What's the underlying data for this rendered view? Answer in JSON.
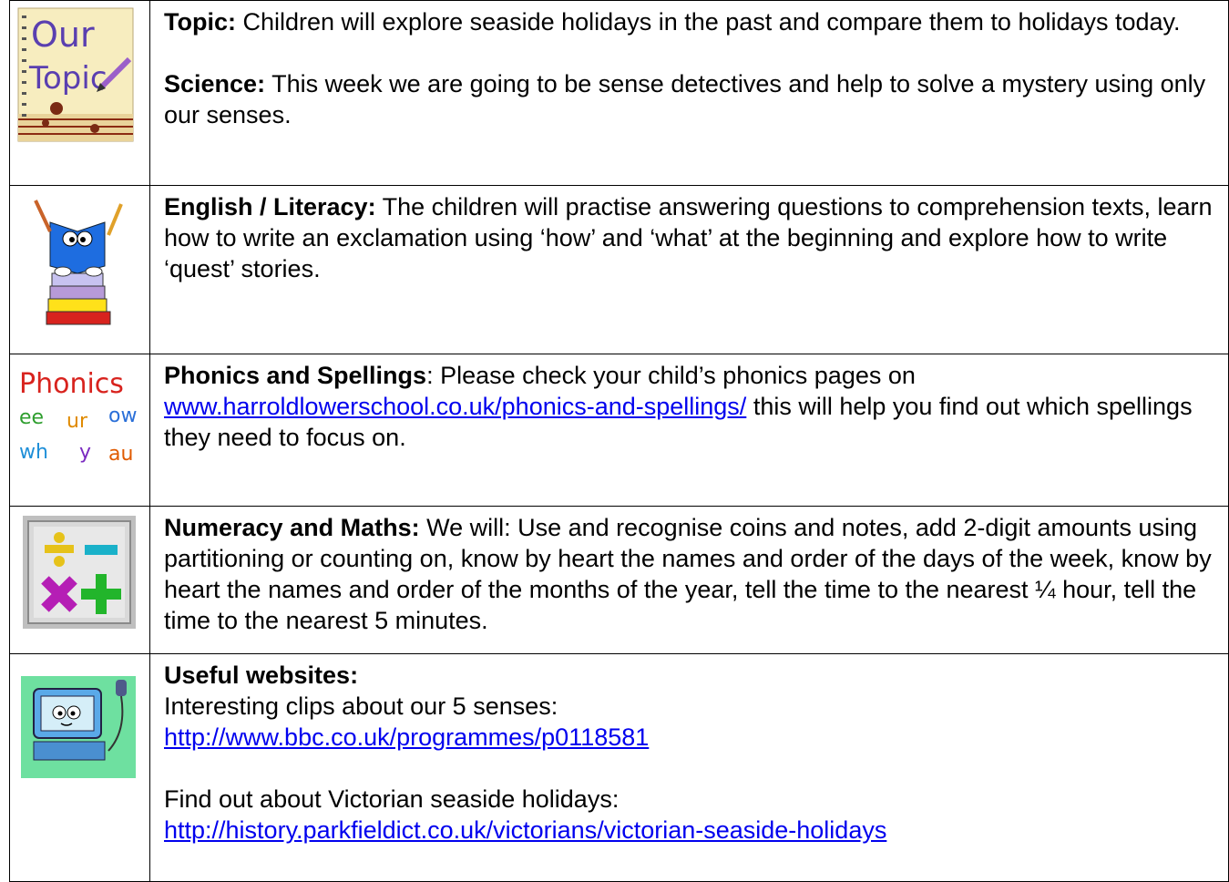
{
  "rows": {
    "topic": {
      "icon": "our-topic-notebook-icon",
      "icon_text_1": "Our",
      "icon_text_2": "Topic",
      "topic_label": "Topic:",
      "topic_text": " Children will explore seaside holidays in the past and compare them to holidays today.",
      "science_label": "Science:",
      "science_text": " This week we are going to be sense detectives and help to solve a mystery using only our senses."
    },
    "english": {
      "icon": "reading-book-character-icon",
      "label": "English / Literacy:",
      "text": " The children will practise answering questions to comprehension texts, learn how to write an exclamation using ‘how’ and ‘what’ at the beginning and explore how to write ‘quest’ stories."
    },
    "phonics": {
      "icon": "phonics-letters-icon",
      "icon_title": "Phonics",
      "icon_sounds_1": [
        "ee",
        "ur",
        "ow"
      ],
      "icon_sounds_2": [
        "wh",
        "y",
        "au"
      ],
      "label": "Phonics and Spellings",
      "text_before": ": Please check your child’s phonics pages on ",
      "link": "www.harroldlowerschool.co.uk/phonics-and-spellings/",
      "text_after": " this will help you find out which spellings they need to focus on."
    },
    "maths": {
      "icon": "math-operators-icon",
      "label": "Numeracy and Maths:",
      "text": " We will: Use and recognise coins and notes, add 2-digit amounts using partitioning or counting on, know by heart the names and order of the days of the week, know by heart the names and order of the months of the year, tell the time to the nearest ¼ hour, tell the time to the nearest 5 minutes."
    },
    "websites": {
      "icon": "computer-character-icon",
      "label": "Useful websites:",
      "line1": "Interesting clips about our 5 senses:",
      "link1": "http://www.bbc.co.uk/programmes/p0118581",
      "line2": "Find out about Victorian seaside holidays:",
      "link2": "http://history.parkfieldict.co.uk/victorians/victorian-seaside-holidays"
    }
  }
}
